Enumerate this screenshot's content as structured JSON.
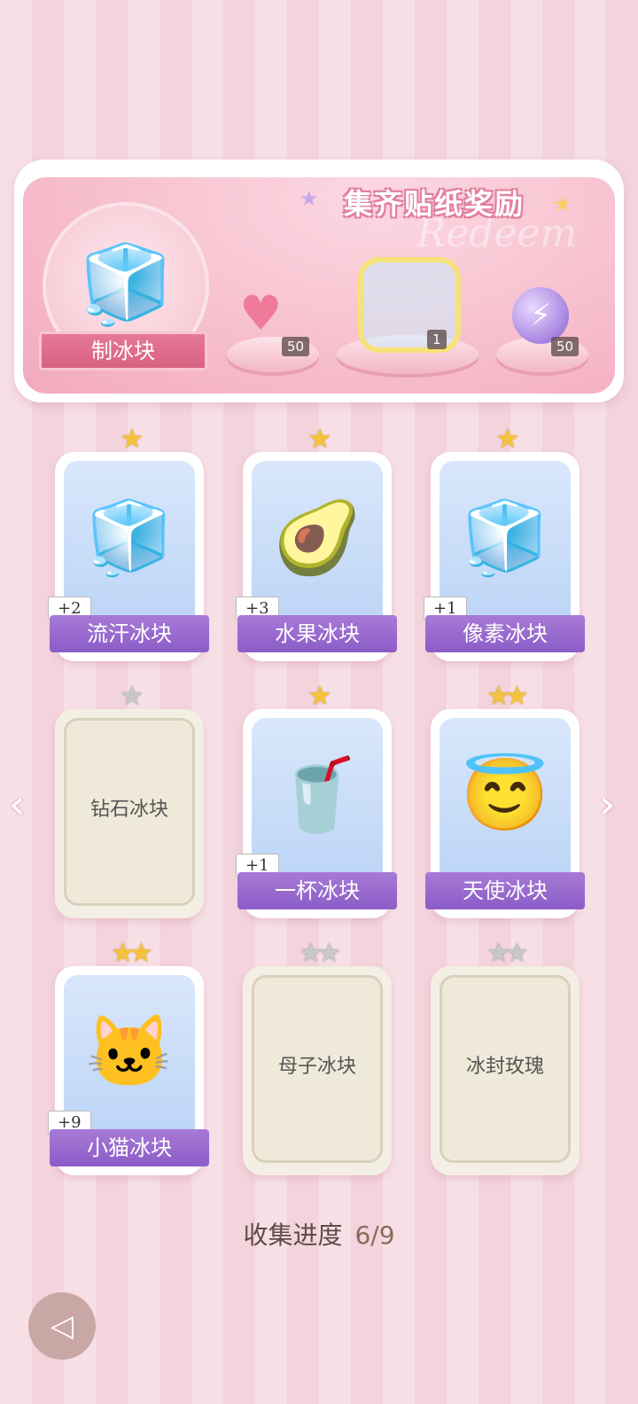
{
  "banner": {
    "title": "集齐贴纸奖励",
    "watermark": "Redeem",
    "make_button": "制冰块",
    "rewards": [
      {
        "icon": "heart-gem-icon",
        "count": "50"
      },
      {
        "icon": "sticker-frame-icon",
        "count": "1"
      },
      {
        "icon": "lightning-orb-icon",
        "count": "50"
      }
    ]
  },
  "cards": [
    {
      "name": "流汗冰块",
      "plus": "+2",
      "stars": "★",
      "locked": false,
      "icon": "sweating-ice-cube"
    },
    {
      "name": "水果冰块",
      "plus": "+3",
      "stars": "★",
      "locked": false,
      "icon": "avocado-ice-cube"
    },
    {
      "name": "像素冰块",
      "plus": "+1",
      "stars": "★",
      "locked": false,
      "icon": "pixel-ice-cube"
    },
    {
      "name": "钻石冰块",
      "plus": "",
      "stars": "★",
      "locked": true,
      "icon": ""
    },
    {
      "name": "一杯冰块",
      "plus": "+1",
      "stars": "★",
      "locked": false,
      "icon": "cup-of-ice"
    },
    {
      "name": "天使冰块",
      "plus": "",
      "stars": "★★",
      "locked": false,
      "icon": "angel-ice-cube"
    },
    {
      "name": "小猫冰块",
      "plus": "+9",
      "stars": "★★",
      "locked": false,
      "icon": "cat-ice-cube"
    },
    {
      "name": "母子冰块",
      "plus": "",
      "stars": "★★",
      "locked": true,
      "icon": ""
    },
    {
      "name": "冰封玫瑰",
      "plus": "",
      "stars": "★★",
      "locked": true,
      "icon": ""
    }
  ],
  "progress": {
    "label": "收集进度",
    "value": "6/9"
  },
  "colors": {
    "accent_purple": "#8c5cc7",
    "pink": "#e77a9a",
    "star_gold": "#f5c23c"
  }
}
